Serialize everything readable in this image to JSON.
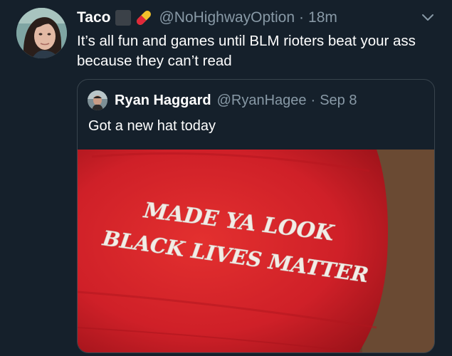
{
  "tweet": {
    "display_name": "Taco",
    "handle": "@NoHighwayOption",
    "separator": "·",
    "time": "18m",
    "text": "It’s all fun and games until BLM rioters beat your ass because they can’t read"
  },
  "quoted_tweet": {
    "display_name": "Ryan Haggard",
    "handle": "@RyanHagee",
    "separator": "·",
    "date": "Sep 8",
    "text": "Got a new hat today",
    "image": {
      "subject": "red hat",
      "line1": "MADE YA LOOK",
      "line2": "BLACK LIVES MATTER"
    }
  },
  "icons": {
    "menu": "chevron-down-icon",
    "emoji1": "black-square-emoji",
    "emoji2": "pill-emoji"
  },
  "colors": {
    "background": "#15202b",
    "secondary_text": "#8899a6",
    "border": "#38444d",
    "hat_red": "#d8262d"
  }
}
